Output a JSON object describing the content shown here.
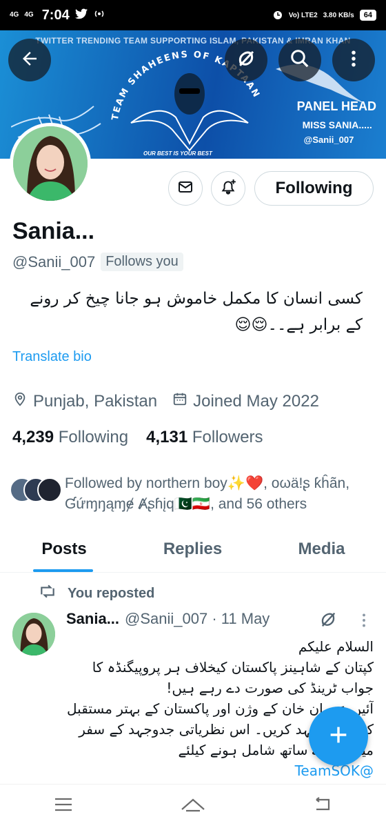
{
  "status_bar": {
    "network_1": "4G",
    "network_2": "4G",
    "time": "7:04",
    "volte": "Vo) LTE2",
    "speed": "3.80 KB/s",
    "battery": "64"
  },
  "banner": {
    "top_text": "TWITTER TRENDING TEAM SUPPORTING ISLAM, PAKISTAN & IMRAN KHAN",
    "arc_text": "TEAM SHAHEENS OF KAPTAAN",
    "motto": "OUR BEST IS YOUR BEST",
    "panel_title": "PANEL HEAD",
    "panel_name": "MISS SANIA.....",
    "panel_handle": "@Sanii_007"
  },
  "profile": {
    "name": "Sania...",
    "handle": "@Sanii_007",
    "follows_you": "Follows you",
    "bio": "کسی انسان کا مکمل خاموش ہو جانا چیخ کر رونے کے برابر ہے۔۔😌😌",
    "translate": "Translate bio",
    "location": "Punjab, Pakistan",
    "joined": "Joined May 2022",
    "following_count": "4,239",
    "following_label": "Following",
    "followers_count": "4,131",
    "followers_label": "Followers",
    "followed_by": "Followed by northern boy✨❤️, oωä!ʂ ƙĥãn, Ɠứɱŋąɱɇ Ⱥʂɦįq🇵🇰🇮🇷, and 56 others",
    "following_button": "Following"
  },
  "tabs": [
    {
      "label": "Posts"
    },
    {
      "label": "Replies"
    },
    {
      "label": "Media"
    }
  ],
  "post": {
    "repost_label": "You reposted",
    "name": "Sania...",
    "handle_time": "@Sanii_007 · 11 May",
    "line1": "السلام علیکم",
    "line2": "کپتان کے شاہینز پاکستان کیخلاف ہر پروپیگنڈہ کا جواب ٹرینڈ کی صورت دے رہے ہیں!",
    "line3": "آئیں عمران خان کے وژن اور پاکستان کے بہتر مستقبل کیلئے جدوجہد کریں۔ اس نظریاتی جدوجہد کے سفر میں ہمارے ساتھ شامل ہونے کیلئے",
    "mention": "@TeamSOK"
  },
  "colors": {
    "accent": "#1d9bf0",
    "muted": "#536471",
    "text": "#0f1419"
  },
  "icons": {
    "back": "arrow-left-icon",
    "grok": "grok-icon",
    "search": "search-icon",
    "more": "more-vertical-icon",
    "message": "envelope-icon",
    "notify": "bell-plus-icon",
    "location": "location-pin-icon",
    "calendar": "calendar-icon",
    "repost": "repost-icon",
    "compose": "plus-icon"
  }
}
